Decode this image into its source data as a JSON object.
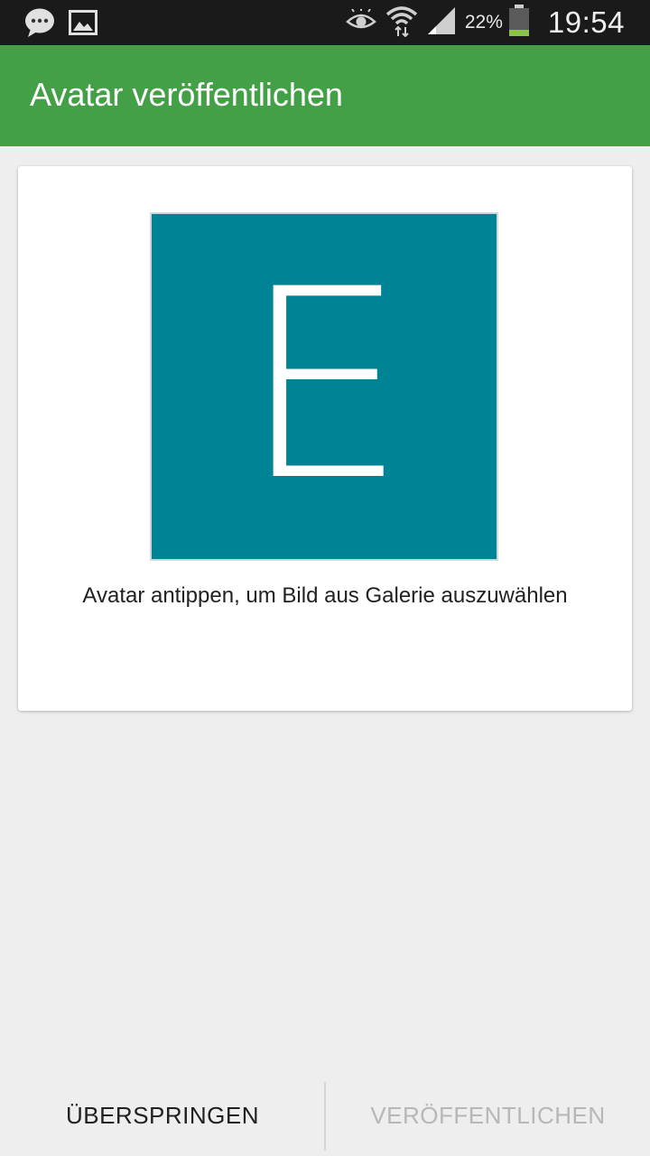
{
  "status_bar": {
    "battery_percent": "22%",
    "time": "19:54",
    "left_icons": [
      "chat-bubble-icon",
      "image-icon"
    ],
    "right_icons": [
      "eye-icon",
      "wifi-icon",
      "signal-icon",
      "battery-icon"
    ],
    "battery_fill_color": "#8bc34a"
  },
  "app_bar": {
    "title": "Avatar veröffentlichen",
    "color": "#43a047"
  },
  "card": {
    "avatar_letter": "E",
    "avatar_color": "#008394",
    "hint": "Avatar antippen, um Bild aus Galerie auszuwählen"
  },
  "actions": {
    "skip_label": "ÜBERSPRINGEN",
    "publish_label": "VERÖFFENTLICHEN",
    "publish_enabled": false
  }
}
